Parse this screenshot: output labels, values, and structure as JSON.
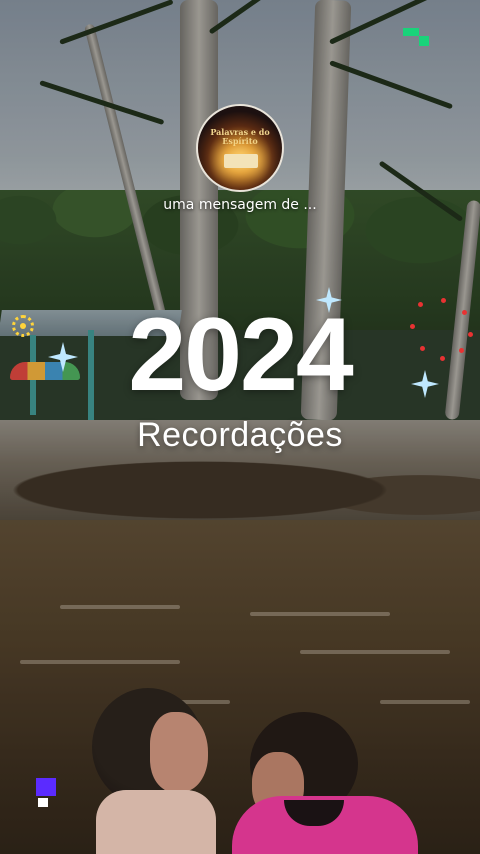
{
  "story": {
    "profile_caption": "uma mensagem de ...",
    "profile_image_text": "Palavras e do Espírito",
    "headline_year": "2024",
    "headline_subtitle": "Recordações"
  },
  "colors": {
    "text": "#ffffff",
    "sparkle": "#bfe8ff",
    "corner_badge_top": "#19d37a",
    "corner_badge_bottom": "#5b2bff"
  },
  "icons": {
    "top_corner": "pixel-badge-icon",
    "bottom_corner": "pixel-badge-icon",
    "sparkles": "sparkle-icon",
    "sun": "sun-icon"
  }
}
